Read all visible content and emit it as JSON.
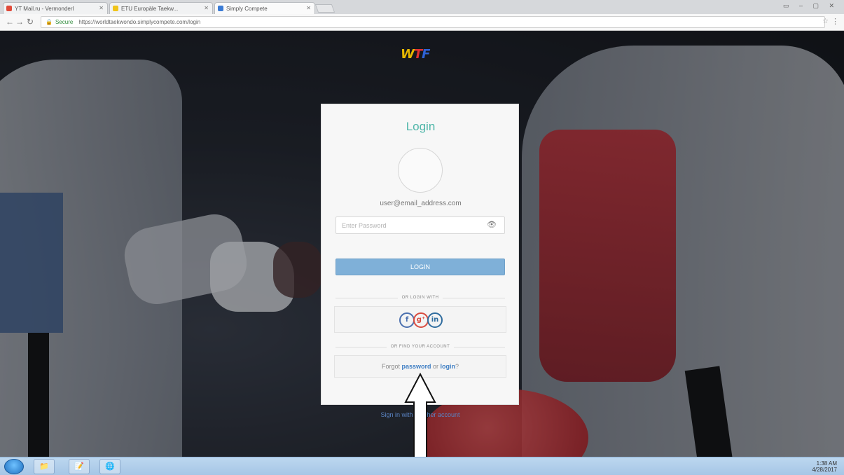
{
  "browser": {
    "tabs": [
      {
        "label": "YT Mail.ru - Vermonderl"
      },
      {
        "label": "ETU Europäle Taekw..."
      },
      {
        "label": "Simply Compete"
      }
    ],
    "url_secure_label": "Secure",
    "url": "https://worldtaekwondo.simplycompete.com/login"
  },
  "page": {
    "logo": {
      "w": "W",
      "t1": "T",
      "t2": "F"
    },
    "login": {
      "title": "Login",
      "email": "user@email_address.com",
      "password_placeholder": "Enter Password",
      "login_button": "LOGIN",
      "social_divider": "OR LOGIN WITH",
      "social": {
        "facebook": "f",
        "google": "g⁺",
        "linkedin": "in"
      },
      "find_divider": "OR FIND YOUR ACCOUNT",
      "forgot_prefix": "Forgot ",
      "forgot_link": "password",
      "forgot_middle": " or ",
      "forgot_login": "login",
      "forgot_suffix": "?"
    },
    "signin_other": "Sign in with another account"
  },
  "taskbar": {
    "clock_time": "1:38 AM",
    "clock_date": "4/28/2017"
  },
  "colors": {
    "accent_teal": "#4fb6a9",
    "login_button": "#7fb0d8",
    "link_blue": "#3f7fc4"
  }
}
